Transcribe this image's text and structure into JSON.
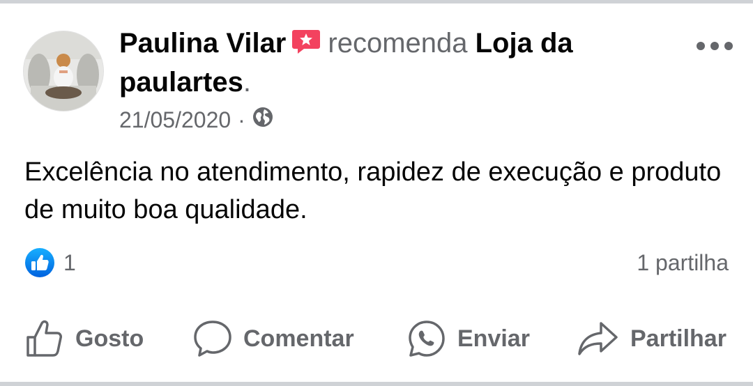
{
  "post": {
    "author": "Paulina Vilar",
    "verb": "recomenda",
    "page_name": "Loja da paulartes",
    "punct": ".",
    "date": "21/05/2020",
    "separator": "·",
    "audience_icon": "globe-icon",
    "body": "Excelência no atendimento, rapidez de execução e produto de muito boa qualidade."
  },
  "stats": {
    "reaction_icon": "like-reaction-icon",
    "reactions": "1",
    "shares": "1 partilha"
  },
  "actions": {
    "like": "Gosto",
    "comment": "Comentar",
    "send": "Enviar",
    "share": "Partilhar"
  },
  "colors": {
    "like_blue": "#1877f2",
    "recommend_red": "#f3425f",
    "secondary_text": "#65676b",
    "divider": "#cfd2d6"
  }
}
